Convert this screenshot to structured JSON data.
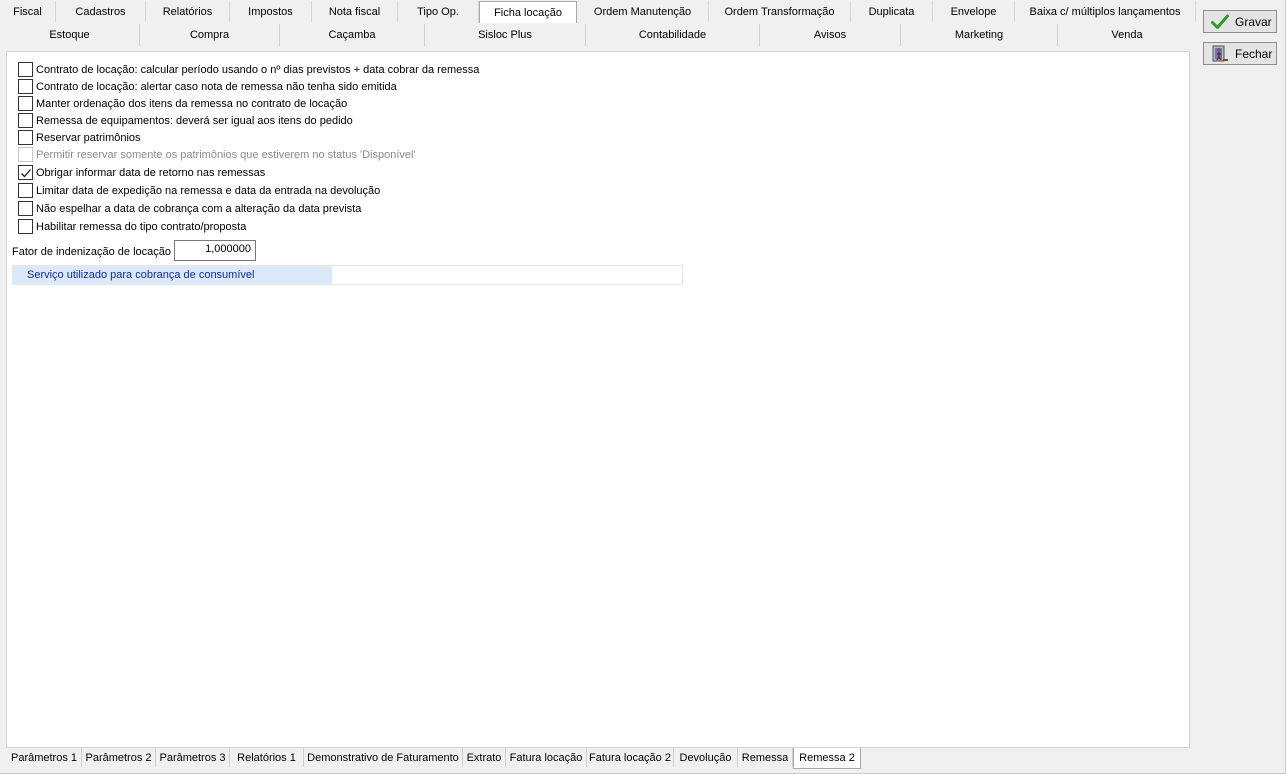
{
  "top_tabs_row1": [
    {
      "label": "Fiscal",
      "w": 56
    },
    {
      "label": "Cadastros",
      "w": 90
    },
    {
      "label": "Relatórios",
      "w": 84
    },
    {
      "label": "Impostos",
      "w": 82
    },
    {
      "label": "Nota fiscal",
      "w": 86
    },
    {
      "label": "Tipo Op.",
      "w": 81
    },
    {
      "label": "Ficha locação",
      "w": 98,
      "active": true
    },
    {
      "label": "Ordem Manutenção",
      "w": 132
    },
    {
      "label": "Ordem Transformação",
      "w": 142
    },
    {
      "label": "Duplicata",
      "w": 82
    },
    {
      "label": "Envelope",
      "w": 82
    },
    {
      "label": "Baixa c/ múltiplos lançamentos",
      "w": 181
    }
  ],
  "top_tabs_row2": [
    {
      "label": "Estoque",
      "w": 140
    },
    {
      "label": "Compra",
      "w": 140
    },
    {
      "label": "Caçamba",
      "w": 145
    },
    {
      "label": "Sisloc Plus",
      "w": 161
    },
    {
      "label": "Contabilidade",
      "w": 174
    },
    {
      "label": "Avisos",
      "w": 141
    },
    {
      "label": "Marketing",
      "w": 157
    },
    {
      "label": "Venda",
      "w": 138
    }
  ],
  "options": [
    {
      "label": "Contrato de locação: calcular período usando o nº dias previstos + data cobrar da remessa",
      "checked": false
    },
    {
      "label": "Contrato de locação: alertar caso nota de remessa não tenha sido emitida",
      "checked": false
    },
    {
      "label": "Manter ordenação dos itens da remessa no contrato de locação",
      "checked": false
    },
    {
      "label": "Remessa de equipamentos: deverá ser igual aos itens do pedido",
      "checked": false
    },
    {
      "label": "Reservar patrimônios",
      "checked": false
    },
    {
      "label": "Permitir reservar somente os patrimônios que estiverem no status 'Disponível'",
      "checked": false,
      "disabled": true
    },
    {
      "label": "Obrigar informar data de retorno nas remessas",
      "checked": true
    },
    {
      "label": "Limitar data de expedição na remessa e data da entrada na devolução",
      "checked": false
    },
    {
      "label": "Não espelhar a data de cobrança com a alteração da data prevista",
      "checked": false
    },
    {
      "label": "Habilitar remessa do tipo contrato/proposta",
      "checked": false
    }
  ],
  "fator": {
    "label": "Fator de indenização de locação",
    "value": "1,000000"
  },
  "servico": {
    "label": "Serviço utilizado para cobrança de consumível",
    "value": ""
  },
  "buttons": {
    "gravar": "Gravar",
    "fechar": "Fechar"
  },
  "bottom_tabs": [
    {
      "label": "Parâmetros 1",
      "w": 75
    },
    {
      "label": "Parâmetros 2",
      "w": 74
    },
    {
      "label": "Parâmetros 3",
      "w": 74
    },
    {
      "label": "Relatórios 1",
      "w": 74
    },
    {
      "label": "Demonstrativo de Faturamento",
      "w": 159
    },
    {
      "label": "Extrato",
      "w": 43
    },
    {
      "label": "Fatura locação",
      "w": 81
    },
    {
      "label": "Fatura locação 2",
      "w": 87
    },
    {
      "label": "Devolução",
      "w": 64
    },
    {
      "label": "Remessa",
      "w": 55
    },
    {
      "label": "Remessa 2",
      "w": 68,
      "active": true
    }
  ],
  "colors": {
    "accent": "#dbe9fb",
    "check": "#2f9a2f"
  }
}
